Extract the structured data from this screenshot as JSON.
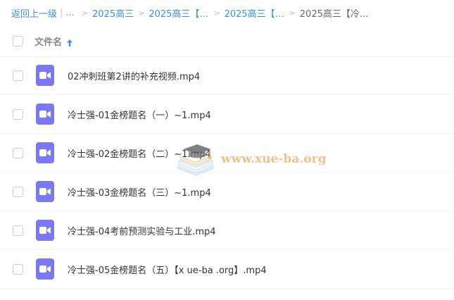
{
  "breadcrumb": {
    "back": "返回上一级",
    "ellipsis": "...",
    "items": [
      "2025高三",
      "2025高三【押...",
      "2025高三【化...",
      "2025高三【冷..."
    ]
  },
  "header": {
    "column_label": "文件名"
  },
  "files": [
    {
      "name": "02冲刺班第2讲的补充视频.mp4"
    },
    {
      "name": "冷士强-01金榜题名（一）~1.mp4"
    },
    {
      "name": "冷士强-02金榜题名（二）~1.mp4"
    },
    {
      "name": "冷士强-03金榜题名（三）~1.mp4"
    },
    {
      "name": "冷士强-04考前预测实验与工业.mp4"
    },
    {
      "name": "冷士强-05金榜题名（五）【x ue-ba .org】.mp4"
    }
  ],
  "watermark": {
    "text": "www.xue-ba.org"
  },
  "colors": {
    "link": "#3a8ee6",
    "video_icon": "#7b79f2",
    "watermark": "#e8a050"
  },
  "icons": {
    "sort": "arrow-up-icon",
    "file": "video-file-icon",
    "watermark_logo": "graduation-cap-books-icon"
  }
}
